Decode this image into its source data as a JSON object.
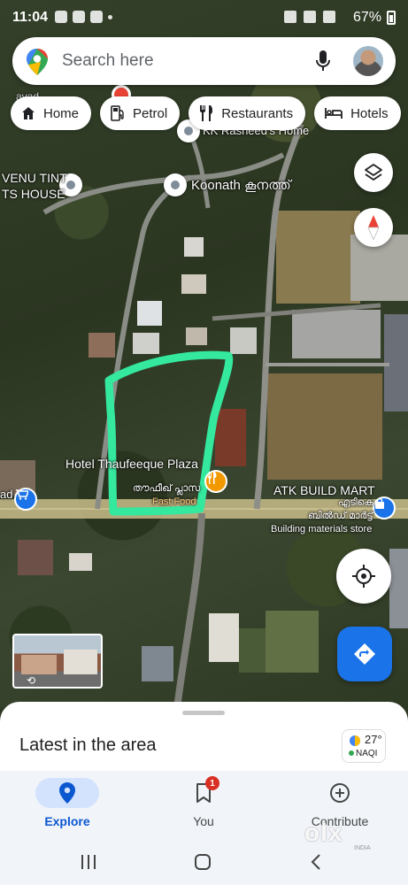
{
  "status_bar": {
    "time": "11:04",
    "battery": "67%",
    "battery_level": 0.67
  },
  "search": {
    "placeholder": "Search here"
  },
  "chips": [
    {
      "label": "Home",
      "icon": "home-icon"
    },
    {
      "label": "Petrol",
      "icon": "fuel-pump-icon"
    },
    {
      "label": "Restaurants",
      "icon": "fork-knife-icon"
    },
    {
      "label": "Hotels",
      "icon": "bed-icon"
    }
  ],
  "map": {
    "labels": {
      "kk_rasheed": "KK Rasheed's Home",
      "venu_tint_1": "VENU TINT",
      "venu_tint_2": "TS HOUSE",
      "koonath": "Koonath കൂനത്ത്",
      "hotel": "Hotel Thaufeeque Plaza",
      "hotel_ml": "തൗഫീഖ് പ്ലാസ",
      "fast_food": "Fast Food",
      "atk": "ATK BUILD MART",
      "atk_ml_1": "എടികെ",
      "atk_ml_2": "ബിൽഡ് മാർട്ട്",
      "atk_sub": "Building materials store",
      "left_edge_1": "avad",
      "left_edge_2": "ad"
    },
    "highlight_color": "#34e89e",
    "accent_color": "#1a73e8"
  },
  "sheet": {
    "title": "Latest in the area",
    "weather_temp": "27°",
    "weather_aqi": "NAQI"
  },
  "nav": {
    "explore": "Explore",
    "you": "You",
    "you_badge": "1",
    "contribute": "Contribute"
  },
  "watermark": {
    "brand": "olx",
    "sub": "INDIA"
  }
}
